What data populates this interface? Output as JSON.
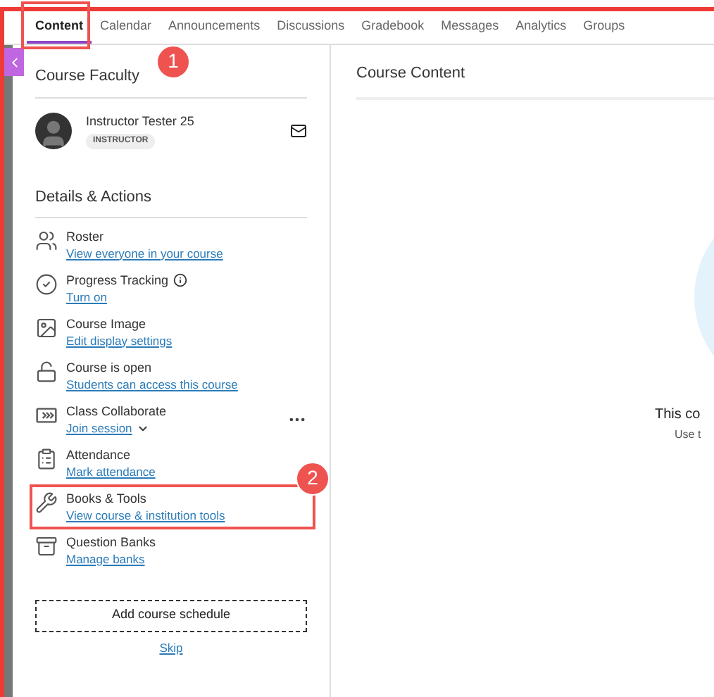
{
  "tabs": [
    {
      "label": "Content",
      "selected": true,
      "annotation": "1"
    },
    {
      "label": "Calendar",
      "selected": false
    },
    {
      "label": "Announcements",
      "selected": false
    },
    {
      "label": "Discussions",
      "selected": false
    },
    {
      "label": "Gradebook",
      "selected": false
    },
    {
      "label": "Messages",
      "selected": false
    },
    {
      "label": "Analytics",
      "selected": false
    },
    {
      "label": "Groups",
      "selected": false
    }
  ],
  "faculty": {
    "heading": "Course Faculty",
    "members": [
      {
        "name": "Instructor Tester 25",
        "role": "INSTRUCTOR"
      }
    ]
  },
  "details": {
    "heading": "Details & Actions",
    "items": [
      {
        "kind": "roster",
        "title": "Roster",
        "link": "View everyone in your course"
      },
      {
        "kind": "progress",
        "title": "Progress Tracking",
        "link": "Turn on",
        "info": true
      },
      {
        "kind": "image",
        "title": "Course Image",
        "link": "Edit display settings"
      },
      {
        "kind": "lock",
        "title": "Course is open",
        "link": "Students can access this course"
      },
      {
        "kind": "collaborate",
        "title": "Class Collaborate",
        "link": "Join session",
        "dropdown": true,
        "more_menu": true
      },
      {
        "kind": "attendance",
        "title": "Attendance",
        "link": "Mark attendance"
      },
      {
        "kind": "tools",
        "title": "Books & Tools",
        "link": "View course & institution tools",
        "annotation": "2"
      },
      {
        "kind": "banks",
        "title": "Question Banks",
        "link": "Manage banks"
      }
    ]
  },
  "schedule_button": "Add course schedule",
  "skip_link": "Skip",
  "content": {
    "heading": "Course Content",
    "empty_title": "This co",
    "empty_hint": "Use t"
  }
}
